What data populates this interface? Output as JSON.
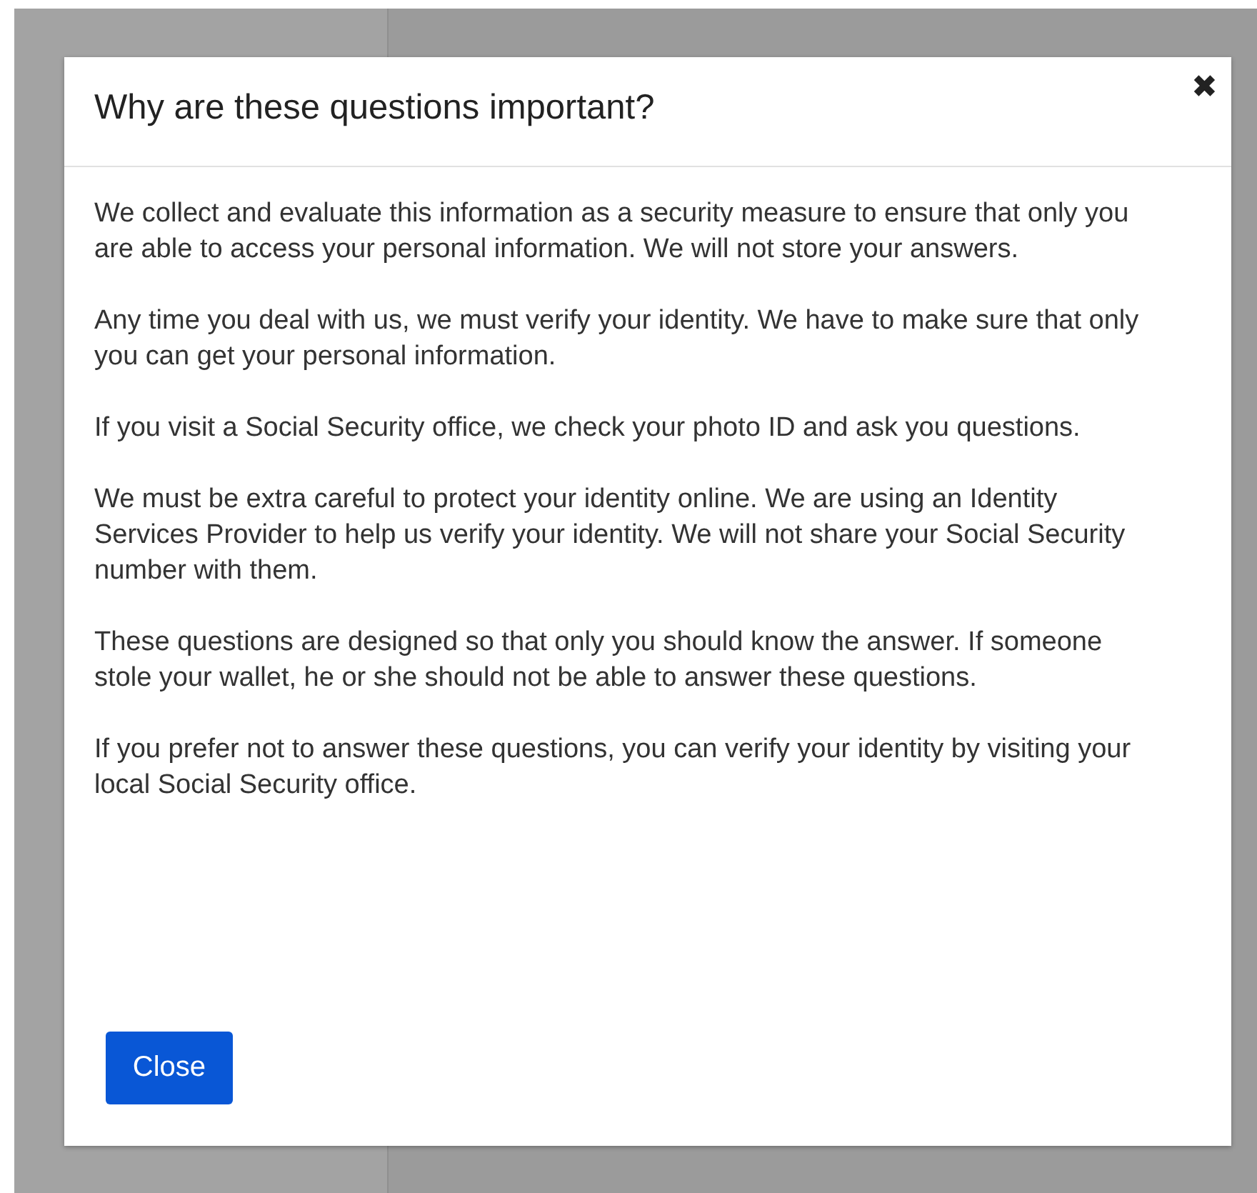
{
  "dialog": {
    "title": "Why are these questions important?",
    "close_icon": "✖",
    "paragraphs": [
      "We collect and evaluate this information as a security measure to ensure that only you are able to access your personal information. We will not store your answers.",
      "Any time you deal with us, we must verify your identity. We have to make sure that only you can get your personal information.",
      "If you visit a Social Security office, we check your photo ID and ask you questions.",
      "We must be extra careful to protect your identity online. We are using an Identity Services Provider to help us verify your identity. We will not share your Social Security number with them.",
      "These questions are designed so that only you should know the answer. If someone stole your wallet, he or she should not be able to answer these questions.",
      "If you prefer not to answer these questions, you can verify your identity by visiting your local Social Security office."
    ],
    "button": "Close"
  }
}
